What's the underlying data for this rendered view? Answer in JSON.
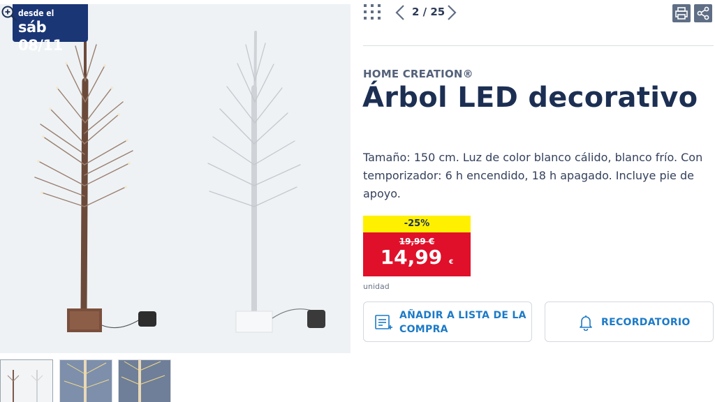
{
  "badge": {
    "line1": "desde el",
    "line2": "sáb 08/11"
  },
  "pager": {
    "current": "2",
    "separator": "/",
    "total": "25",
    "text": "2 / 25"
  },
  "product": {
    "brand": "HOME CREATION®",
    "title": "Árbol LED decorativo",
    "description": "Tamaño: 150 cm. Luz de color blanco cálido, blanco frío. Con temporizador: 6 h encendido, 18 h apagado. Incluye pie de apoyo."
  },
  "pricing": {
    "discount": "-25%",
    "old_price": "19,99 €",
    "price": "14,99",
    "currency": "€",
    "unit": "unidad"
  },
  "buttons": {
    "add_list_line1": "AÑADIR A LISTA DE LA",
    "add_list_line2": "COMPRA",
    "reminder": "RECORDATORIO"
  },
  "icons": {
    "grid": "grid-icon",
    "prev": "chevron-left-icon",
    "next": "chevron-right-icon",
    "print": "print-icon",
    "share": "share-icon",
    "zoom": "zoom-in-icon",
    "list": "list-add-icon",
    "bell": "bell-icon"
  },
  "colors": {
    "badge": "#1a3675",
    "discount": "#fff000",
    "price": "#e0102a",
    "accent": "#1c7ac7",
    "title": "#1c2f53"
  }
}
